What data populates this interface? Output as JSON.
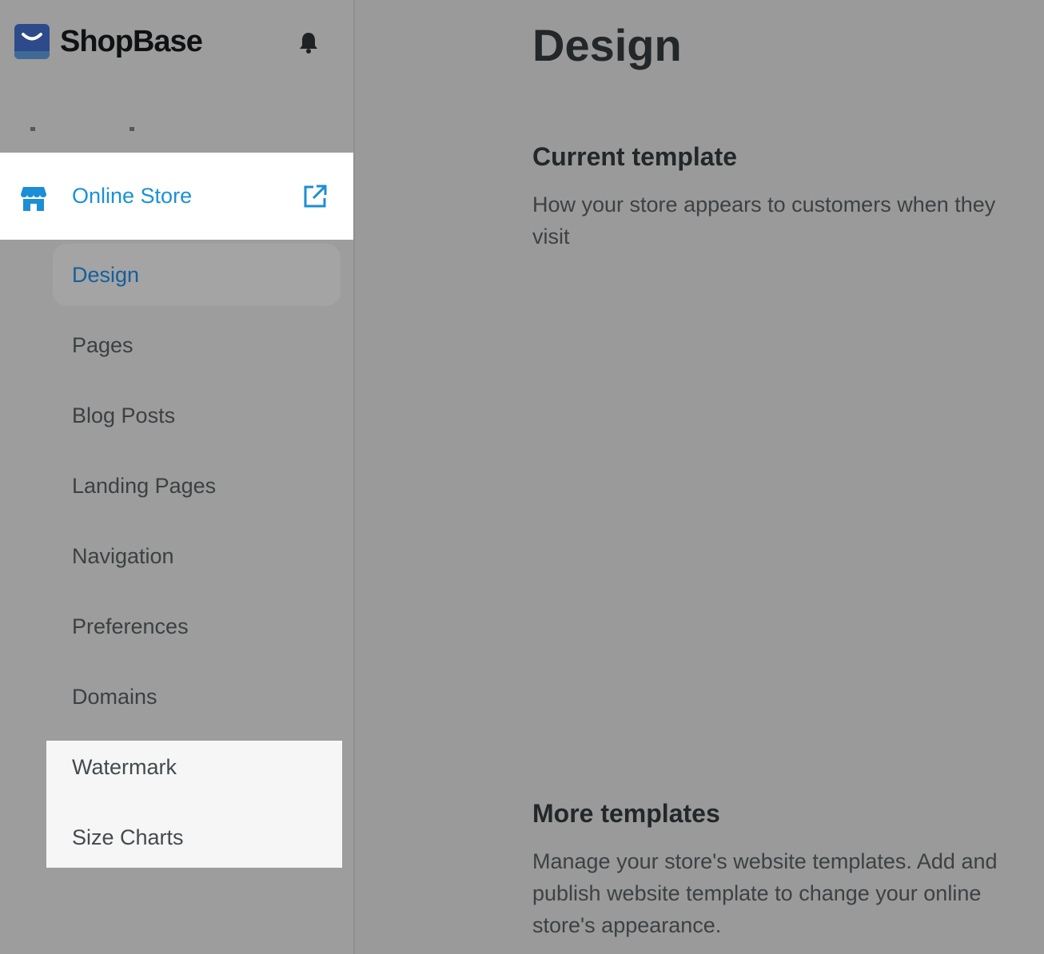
{
  "brand": {
    "name": "ShopBase"
  },
  "sidebar": {
    "active_section": {
      "label": "Online Store"
    },
    "sub_items": [
      {
        "label": "Design",
        "active": true
      },
      {
        "label": "Pages"
      },
      {
        "label": "Blog Posts"
      },
      {
        "label": "Landing Pages"
      },
      {
        "label": "Navigation"
      },
      {
        "label": "Preferences"
      },
      {
        "label": "Domains"
      },
      {
        "label": "Watermark"
      },
      {
        "label": "Size Charts"
      }
    ]
  },
  "main": {
    "title": "Design",
    "current_template": {
      "heading": "Current template",
      "description": "How your store appears to customers when they visit"
    },
    "more_templates": {
      "heading": "More templates",
      "description": "Manage your store's website templates. Add and publish website template to change your online store's appearance."
    }
  },
  "colors": {
    "accent": "#1991d6",
    "brand": "#2d4a8a",
    "overlay": "#9a9b9a"
  },
  "icons": [
    "bell-icon",
    "store-icon",
    "external-link-icon"
  ]
}
